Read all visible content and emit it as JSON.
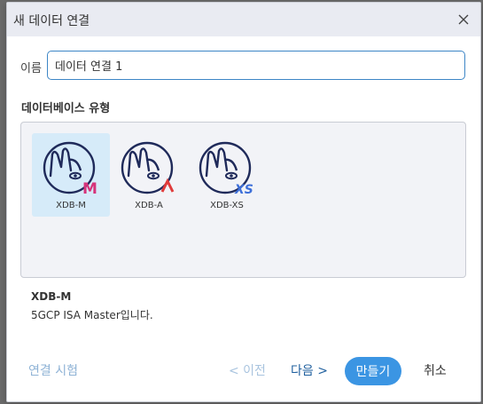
{
  "dialog": {
    "title": "새 데이터 연결",
    "close_icon": "close-icon"
  },
  "name_field": {
    "label": "이름",
    "value": "데이터 연결 1"
  },
  "db_type": {
    "label": "데이터베이스 유형",
    "items": [
      {
        "label": "XDB-M",
        "badge": "M",
        "badge_color": "#d6337a",
        "selected": true
      },
      {
        "label": "XDB-A",
        "badge": "A",
        "badge_color": "#e03b3b",
        "selected": false
      },
      {
        "label": "XDB-XS",
        "badge": "XS",
        "badge_color": "#3d6fd9",
        "selected": false
      }
    ]
  },
  "description": {
    "name": "XDB-M",
    "text": "5GCP ISA Master입니다."
  },
  "buttons": {
    "test": "연결 시험",
    "prev": "< 이전",
    "next": "다음 >",
    "create": "만들기",
    "cancel": "취소"
  },
  "colors": {
    "accent": "#3b95e3",
    "selected_bg": "#d6ebf9",
    "logo_stroke": "#1f2a5a"
  }
}
